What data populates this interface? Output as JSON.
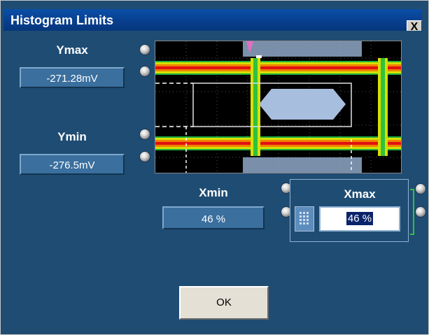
{
  "window": {
    "title": "Histogram Limits",
    "close_glyph": "X"
  },
  "ymax": {
    "label": "Ymax",
    "value": "-271.28mV"
  },
  "ymin": {
    "label": "Ymin",
    "value": "-276.5mV"
  },
  "xmin": {
    "label": "Xmin",
    "value": "46 %"
  },
  "xmax": {
    "label": "Xmax",
    "value": "46 %"
  },
  "ok_button": {
    "label": "OK"
  },
  "icons": {
    "knob": "knob-icon",
    "keypad": "keypad-icon",
    "close": "close-icon"
  },
  "colors": {
    "client_background": "#1f4c73",
    "titlebar": "#0a4fa8",
    "field": "#3a6f9e",
    "selection": "#0a246a"
  }
}
